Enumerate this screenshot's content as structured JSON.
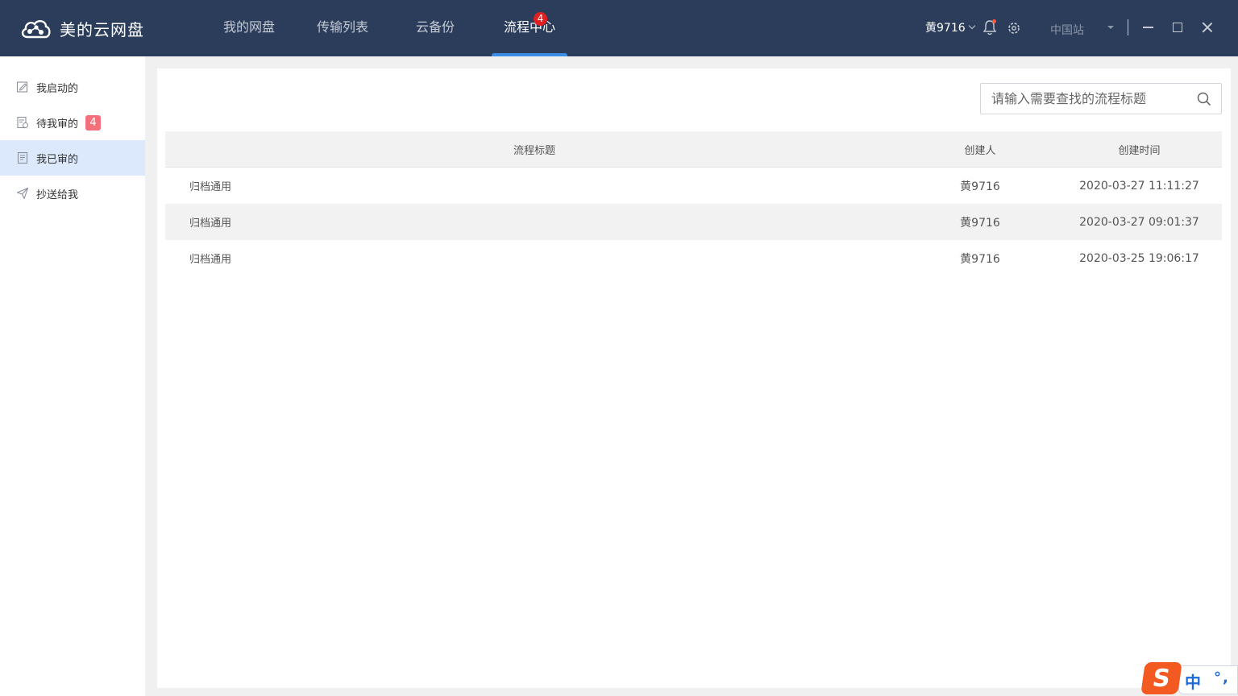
{
  "app": {
    "title": "美的云网盘"
  },
  "nav": [
    {
      "label": "我的网盘"
    },
    {
      "label": "传输列表"
    },
    {
      "label": "云备份"
    },
    {
      "label": "流程中心",
      "badge": "4",
      "active": true
    }
  ],
  "header": {
    "username": "黄9716",
    "site": "中国站",
    "icons": [
      "chevron-down-icon",
      "bell-icon",
      "gear-icon",
      "minimize-icon",
      "maximize-icon",
      "close-icon"
    ]
  },
  "sidebar": {
    "items": [
      {
        "label": "我启动的",
        "icon": "edit-doc-icon"
      },
      {
        "label": "待我审的",
        "icon": "pending-doc-icon",
        "badge": "4"
      },
      {
        "label": "我已审的",
        "icon": "reviewed-doc-icon",
        "active": true
      },
      {
        "label": "抄送给我",
        "icon": "send-icon"
      }
    ]
  },
  "search": {
    "placeholder": "请输入需要查找的流程标题",
    "value": ""
  },
  "table": {
    "headers": {
      "title": "流程标题",
      "creator": "创建人",
      "time": "创建时间"
    },
    "rows": [
      {
        "title": "归档通用",
        "creator": "黄9716",
        "time": "2020-03-27 11:11:27"
      },
      {
        "title": "归档通用",
        "creator": "黄9716",
        "time": "2020-03-27 09:01:37"
      },
      {
        "title": "归档通用",
        "creator": "黄9716",
        "time": "2020-03-25 19:06:17"
      }
    ]
  },
  "ime": {
    "logo": "S",
    "mode": "中",
    "punct": "°,"
  },
  "colors": {
    "topbar": "#2b3d5a",
    "accent": "#3a8ee6",
    "badge_red": "#e02020",
    "side_badge": "#f26f7b",
    "active_side": "#dce8fb"
  }
}
